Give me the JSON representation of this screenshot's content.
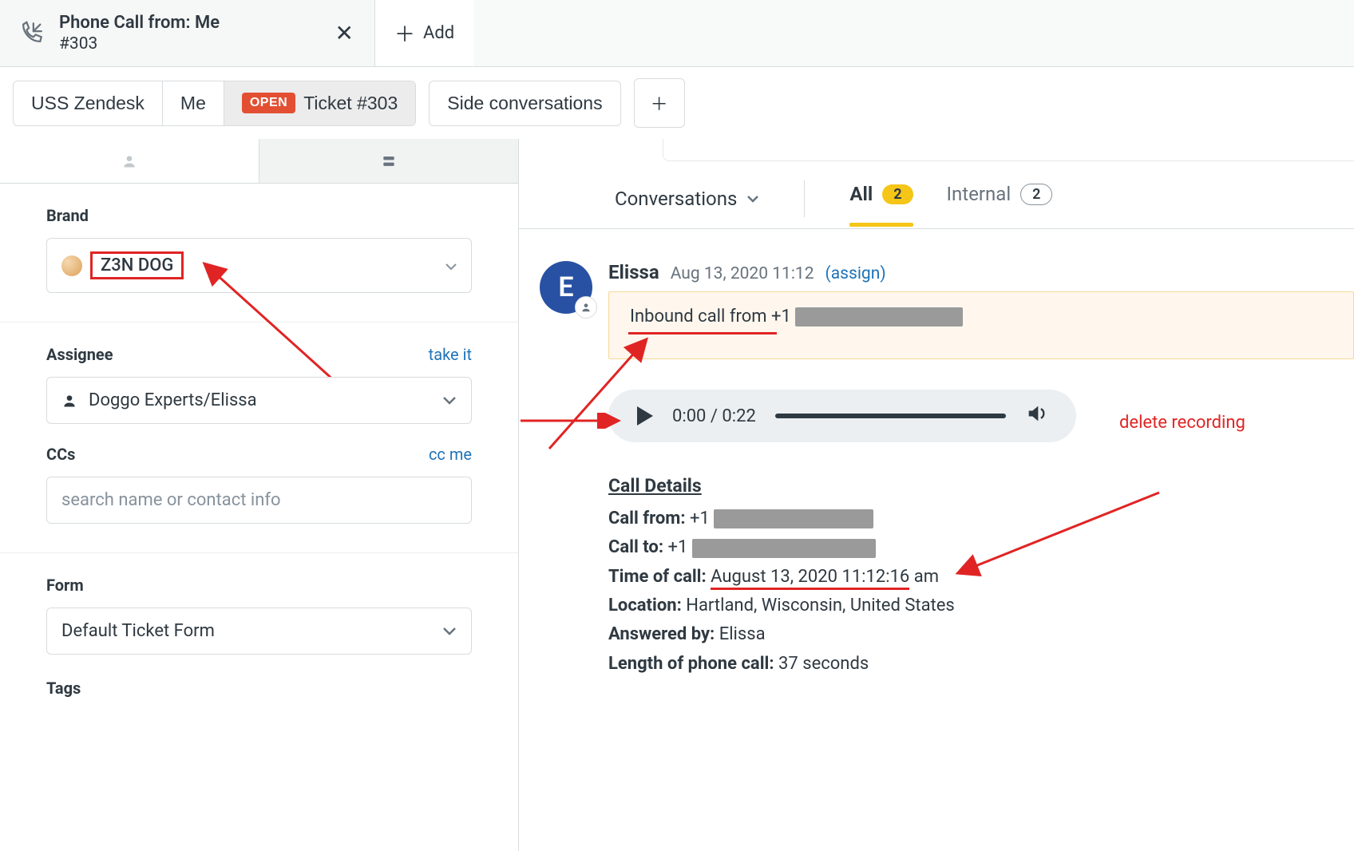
{
  "tab": {
    "title": "Phone Call from: Me",
    "subtitle": "#303",
    "add_label": "Add"
  },
  "breadcrumb": {
    "org": "USS Zendesk",
    "user": "Me",
    "status": "OPEN",
    "ticket": "Ticket #303"
  },
  "side_conv": {
    "label": "Side conversations"
  },
  "sidebar": {
    "brand_label": "Brand",
    "brand_value": "Z3N DOG",
    "assignee_label": "Assignee",
    "assignee_value": "Doggo Experts/Elissa",
    "take_it": "take it",
    "ccs_label": "CCs",
    "cc_me": "cc me",
    "ccs_placeholder": "search name or contact info",
    "form_label": "Form",
    "form_value": "Default Ticket Form",
    "tags_label": "Tags"
  },
  "conversation": {
    "header": "Conversations",
    "tabs": {
      "all": "All",
      "all_count": "2",
      "internal": "Internal",
      "internal_count": "2"
    },
    "author": "Elissa",
    "author_initial": "E",
    "timestamp": "Aug 13, 2020 11:12",
    "assign": "(assign)",
    "note_prefix": "Inbound call ",
    "note_from": "from +1 ",
    "audio": {
      "current": "0:00",
      "total": "0:22"
    },
    "delete_label": "delete recording",
    "details": {
      "title": "Call Details",
      "from_label": "Call from:",
      "from_value": "+1 ",
      "to_label": "Call to:",
      "to_value": "+1 ",
      "time_label": "Time of call:",
      "time_value": "August 13, 2020 11:12:16 am",
      "time_value_underlined": "August 13, 2020 11:12:16",
      "time_value_suffix": " am",
      "location_label": "Location:",
      "location_value": "Hartland, Wisconsin, United States",
      "answered_label": "Answered by:",
      "answered_value": "Elissa",
      "length_label": "Length of phone call:",
      "length_value": "37 seconds"
    }
  }
}
